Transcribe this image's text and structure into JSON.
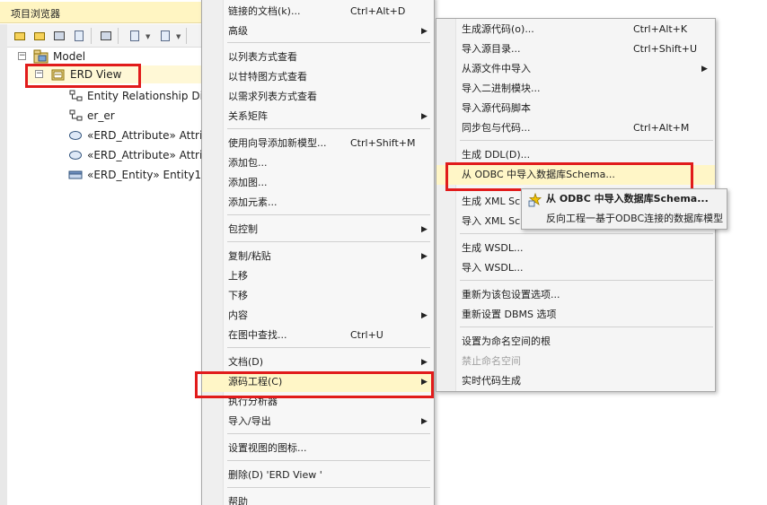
{
  "browser": {
    "title": "项目浏览器",
    "tree": {
      "model": {
        "label": "Model",
        "expander": "−"
      },
      "erd_view": {
        "label": "ERD View",
        "expander": "−"
      },
      "children": [
        {
          "label": "Entity Relationship Dia",
          "icon": "diagram-icon"
        },
        {
          "label": "er_er",
          "icon": "diagram-icon"
        },
        {
          "label": "«ERD_Attribute» Attrib",
          "icon": "ellipse-icon"
        },
        {
          "label": "«ERD_Attribute» Attrib",
          "icon": "ellipse-icon"
        },
        {
          "label": "«ERD_Entity» Entity1",
          "icon": "entity-icon"
        }
      ]
    }
  },
  "context_menu": {
    "items": [
      {
        "label": "链接的文档(k)...",
        "shortcut": "Ctrl+Alt+D",
        "submenu": false
      },
      {
        "label": "高级",
        "shortcut": "",
        "submenu": true
      },
      {
        "label": "以列表方式查看",
        "shortcut": "",
        "submenu": false
      },
      {
        "label": "以甘特图方式查看",
        "shortcut": "",
        "submenu": false
      },
      {
        "label": "以需求列表方式查看",
        "shortcut": "",
        "submenu": false
      },
      {
        "label": "关系矩阵",
        "shortcut": "",
        "submenu": true
      },
      {
        "label": "使用向导添加新模型...",
        "shortcut": "Ctrl+Shift+M",
        "submenu": false
      },
      {
        "label": "添加包...",
        "shortcut": "",
        "submenu": false
      },
      {
        "label": "添加图...",
        "shortcut": "",
        "submenu": false
      },
      {
        "label": "添加元素...",
        "shortcut": "",
        "submenu": false
      },
      {
        "label": "包控制",
        "shortcut": "",
        "submenu": true
      },
      {
        "label": "复制/粘贴",
        "shortcut": "",
        "submenu": true
      },
      {
        "label": "上移",
        "shortcut": "",
        "submenu": false
      },
      {
        "label": "下移",
        "shortcut": "",
        "submenu": false
      },
      {
        "label": "内容",
        "shortcut": "",
        "submenu": true
      },
      {
        "label": "在图中查找...",
        "shortcut": "Ctrl+U",
        "submenu": false
      },
      {
        "label": "文档(D)",
        "shortcut": "",
        "submenu": true
      },
      {
        "label": "源码工程(C)",
        "shortcut": "",
        "submenu": true,
        "highlighted": true
      },
      {
        "label": "执行分析器",
        "shortcut": "",
        "submenu": false
      },
      {
        "label": "导入/导出",
        "shortcut": "",
        "submenu": true
      },
      {
        "label": "设置视图的图标...",
        "shortcut": "",
        "submenu": false
      },
      {
        "label": "删除(D) 'ERD View '",
        "shortcut": "",
        "submenu": false
      },
      {
        "label": "帮助",
        "shortcut": "",
        "submenu": false
      }
    ]
  },
  "code_engineering_menu": {
    "items": [
      {
        "label": "生成源代码(o)...",
        "shortcut": "Ctrl+Alt+K",
        "submenu": false
      },
      {
        "label": "导入源目录...",
        "shortcut": "Ctrl+Shift+U",
        "submenu": false
      },
      {
        "label": "从源文件中导入",
        "shortcut": "",
        "submenu": true
      },
      {
        "label": "导入二进制模块...",
        "shortcut": "",
        "submenu": false
      },
      {
        "label": "导入源代码脚本",
        "shortcut": "",
        "submenu": false
      },
      {
        "label": "同步包与代码...",
        "shortcut": "Ctrl+Alt+M",
        "submenu": false
      },
      {
        "label": "生成 DDL(D)...",
        "shortcut": "",
        "submenu": false
      },
      {
        "label": "从 ODBC 中导入数据库Schema...",
        "shortcut": "",
        "submenu": false,
        "highlighted": true
      },
      {
        "label": "生成 XML Sc",
        "shortcut": "",
        "submenu": false
      },
      {
        "label": "导入 XML Sc",
        "shortcut": "",
        "submenu": false
      },
      {
        "label": "生成 WSDL...",
        "shortcut": "",
        "submenu": false
      },
      {
        "label": "导入 WSDL...",
        "shortcut": "",
        "submenu": false
      },
      {
        "label": "重新为该包设置选项...",
        "shortcut": "",
        "submenu": false
      },
      {
        "label": "重新设置 DBMS 选项",
        "shortcut": "",
        "submenu": false
      },
      {
        "label": "设置为命名空间的根",
        "shortcut": "",
        "submenu": false
      },
      {
        "label": "禁止命名空间",
        "shortcut": "",
        "submenu": false,
        "disabled": true
      },
      {
        "label": "实时代码生成",
        "shortcut": "",
        "submenu": false
      }
    ]
  },
  "odbc_tooltip_menu": {
    "items": [
      {
        "label": "从 ODBC 中导入数据库Schema...",
        "bold": true
      },
      {
        "label": "反向工程一基于ODBC连接的数据库模型",
        "bold": false
      }
    ]
  },
  "colors": {
    "highlight_box": "#e11b1b",
    "hover_bg": "#fff6c7",
    "header_bg": "#fff5c2"
  }
}
